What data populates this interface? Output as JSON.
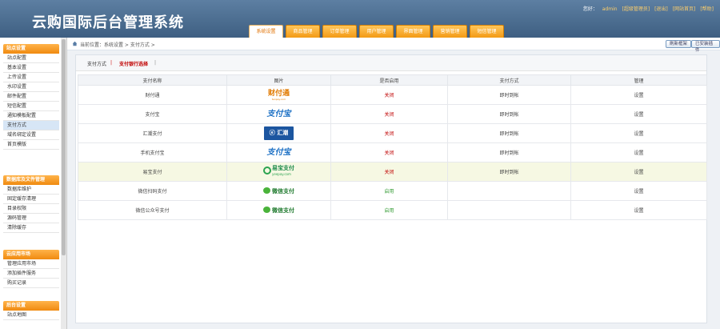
{
  "app_title": "云购国际后台管理系统",
  "top_links": [
    "您好：",
    "admin",
    "[超级管理员]",
    "[退出]",
    "[网站首页]",
    "[帮助]"
  ],
  "tabs": [
    "系统设置",
    "商品管理",
    "订单管理",
    "用户管理",
    "界面管理",
    "营销管理",
    "短信管理"
  ],
  "sidebar": {
    "sections": [
      {
        "title": "站点设置",
        "items": [
          "站点配置",
          "基本设置",
          "上传设置",
          "水印设置",
          "邮件配置",
          "短信配置",
          "通知模板配置",
          "支付方式",
          "域名绑定设置",
          "首页模版"
        ]
      },
      {
        "title": "数据库及文件管理",
        "items": [
          "数据库维护",
          "固定缓存清理",
          "目录权限",
          "源码管理",
          "清除缓存"
        ]
      },
      {
        "title": "云应用市场",
        "items": [
          "管理应用市场",
          "添加插件服务",
          "购买记录"
        ]
      },
      {
        "title": "后台设置",
        "items": [
          "站点地图"
        ]
      }
    ]
  },
  "breadcrumb": "当前位置：系统设置 > 支付方式 >",
  "crumb_buttons": [
    "刷新框架",
    "已安装插件"
  ],
  "subtabs": [
    "支付方式",
    "支付银行选择"
  ],
  "table": {
    "headers": [
      "支付名称",
      "图片",
      "是否启用",
      "支付方式",
      "管理"
    ],
    "rows": [
      {
        "name": "财付通",
        "logo": "财付通",
        "logo_sub": "tenpay.com",
        "status": "关闭",
        "mode": "即时到帐",
        "action": "设置"
      },
      {
        "name": "支付宝",
        "logo": "支付宝",
        "status": "关闭",
        "mode": "即时到帐",
        "action": "设置"
      },
      {
        "name": "汇潮支付",
        "logo": "汇潮",
        "status": "关闭",
        "mode": "即时到帐",
        "action": "设置"
      },
      {
        "name": "手机支付宝",
        "logo": "支付宝",
        "status": "关闭",
        "mode": "即时到帐",
        "action": "设置"
      },
      {
        "name": "易宝支付",
        "logo": "易宝支付",
        "logo_sub": "yeepay.com",
        "status": "关闭",
        "mode": "即时到帐",
        "action": "设置"
      },
      {
        "name": "微信扫码支付",
        "logo": "微信支付",
        "status": "启用",
        "mode": "",
        "action": "设置"
      },
      {
        "name": "微信公众号支付",
        "logo": "微信支付",
        "status": "启用",
        "mode": "",
        "action": "设置"
      }
    ]
  },
  "colors": {
    "accent_orange": "#f39a15",
    "header_blue": "#4a6c90",
    "status_off": "#c00000",
    "status_on": "#2f9a2f"
  }
}
